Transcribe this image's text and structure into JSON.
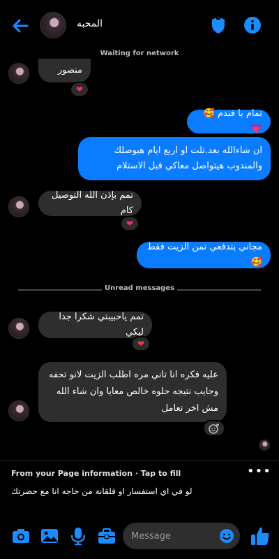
{
  "header": {
    "name": "المحبه",
    "back_icon": "arrow-left-icon",
    "shield_icon": "shield-icon",
    "info_icon": "info-icon"
  },
  "status": {
    "network": "Waiting for network"
  },
  "messages": [
    {
      "dir": "in",
      "text": "منصور",
      "reaction": "❤"
    },
    {
      "dir": "out",
      "text": "تمام يا فندم 🥰💗"
    },
    {
      "dir": "out",
      "text": "ان شاءالله بعد.تلت او اربع ايام هيوصلك والمندوب هيتواصل معاكي قبل الاستلام"
    },
    {
      "dir": "in",
      "text": "تمم بإذن الله التوصيل كام",
      "reaction": "❤"
    },
    {
      "dir": "out",
      "text": "مجاني بتدفعي تمن الزيت فقط 🥰"
    },
    {
      "dir": "in",
      "text": "تمم ياحبيبتي شكرا جدا ليكي",
      "reaction": "❤"
    },
    {
      "dir": "in",
      "text": "عليه فكره انا تاني مره اطلب الزيت لانو تحفه وجايب نتيجه حلوه خالص معايا وان شاء الله مش اخر تعامل"
    }
  ],
  "divider": {
    "unread": "Unread messages"
  },
  "page_info": {
    "title": "From your Page information · Tap to fill",
    "text": "لو في اي استفسار او قلقانة من حاجه انا مع حضرتك",
    "more": "•••"
  },
  "composer": {
    "placeholder": "Message",
    "icons": [
      "camera-icon",
      "image-icon",
      "mic-icon",
      "briefcase-icon",
      "emoji-icon",
      "thumbs-up-icon"
    ]
  },
  "colors": {
    "accent": "#0a7cff",
    "incoming": "#2e2e2e",
    "heart": "#ff2d55",
    "background": "#000000"
  }
}
